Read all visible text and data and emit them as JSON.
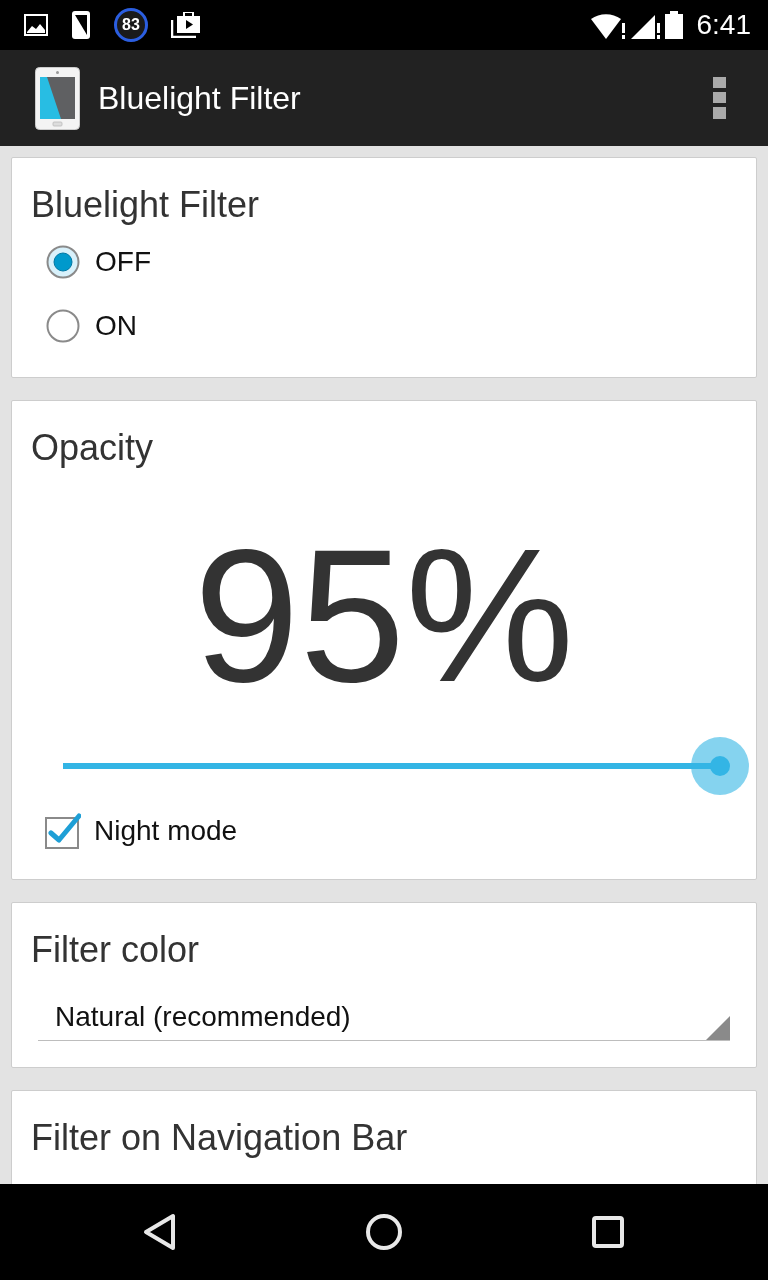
{
  "status_bar": {
    "notification_count": "83",
    "time": "6:41"
  },
  "app_bar": {
    "title": "Bluelight Filter"
  },
  "cards": [
    {
      "kind": "radio_group",
      "title": "Bluelight Filter",
      "options": [
        {
          "label": "OFF",
          "selected": true
        },
        {
          "label": "ON",
          "selected": false
        }
      ]
    },
    {
      "kind": "opacity",
      "title": "Opacity",
      "value": "95%",
      "slider": {
        "level": 1
      },
      "night_mode": {
        "label": "Night mode",
        "checked": true
      }
    },
    {
      "kind": "dropdown",
      "title": "Filter color",
      "value": "Natural (recommended)"
    },
    {
      "kind": "radio_group",
      "title": "Filter on Navigation Bar"
    }
  ]
}
